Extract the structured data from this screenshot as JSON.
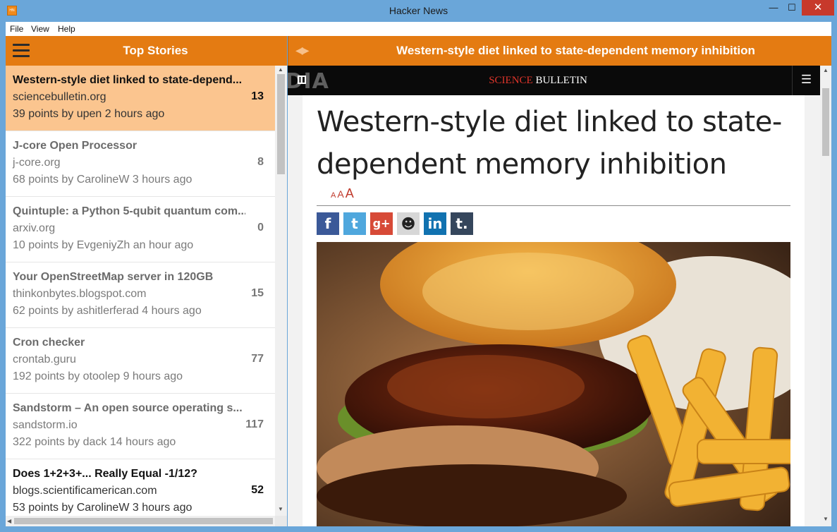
{
  "window": {
    "title": "Hacker News",
    "app_icon_text": "HN",
    "minimize_glyph": "—",
    "maximize_glyph": "☐",
    "close_glyph": "✕"
  },
  "menu": [
    "File",
    "View",
    "Help"
  ],
  "left_panel": {
    "title": "Top Stories",
    "stories": [
      {
        "title": "Western-style diet linked to state-depend...",
        "domain": "sciencebulletin.org",
        "meta": "39 points by upen 2 hours ago",
        "comments": "13",
        "selected": true
      },
      {
        "title": "J-core Open Processor",
        "domain": "j-core.org",
        "meta": "68 points by CarolineW 3 hours ago",
        "comments": "8"
      },
      {
        "title": "Quintuple: a Python 5-qubit quantum com...",
        "domain": "arxiv.org",
        "meta": "10 points by EvgeniyZh an hour ago",
        "comments": "0"
      },
      {
        "title": "Your OpenStreetMap server in 120GB",
        "domain": "thinkonbytes.blogspot.com",
        "meta": "62 points by ashitlerferad 4 hours ago",
        "comments": "15"
      },
      {
        "title": "Cron checker",
        "domain": "crontab.guru",
        "meta": "192 points by otoolep 9 hours ago",
        "comments": "77"
      },
      {
        "title": "Sandstorm – An open source operating s...",
        "domain": "sandstorm.io",
        "meta": "322 points by dack 14 hours ago",
        "comments": "117"
      },
      {
        "title": "Does 1+2+3+... Really Equal -1/12?",
        "domain": "blogs.scientificamerican.com",
        "meta": "53 points by CarolineW 3 hours ago",
        "comments": "52"
      }
    ]
  },
  "right_panel": {
    "title": "Western-style diet linked to state-dependent memory inhibition",
    "nav_arrows": "◀▶",
    "site_brand_red": "SCIENCE",
    "site_brand_white": " BULLETIN",
    "menu_glyph": "☰",
    "headline": "Western-style diet linked to state-dependent memory inhibition",
    "font_sizes": [
      "A",
      "A",
      "A"
    ],
    "share_buttons": [
      {
        "name": "facebook",
        "glyph": "f"
      },
      {
        "name": "twitter",
        "glyph": "t"
      },
      {
        "name": "google-plus",
        "glyph": "g+"
      },
      {
        "name": "reddit",
        "glyph": "☻"
      },
      {
        "name": "linkedin",
        "glyph": "in"
      },
      {
        "name": "tumblr",
        "glyph": "t."
      }
    ]
  },
  "watermark": "SOFTPEDIA"
}
